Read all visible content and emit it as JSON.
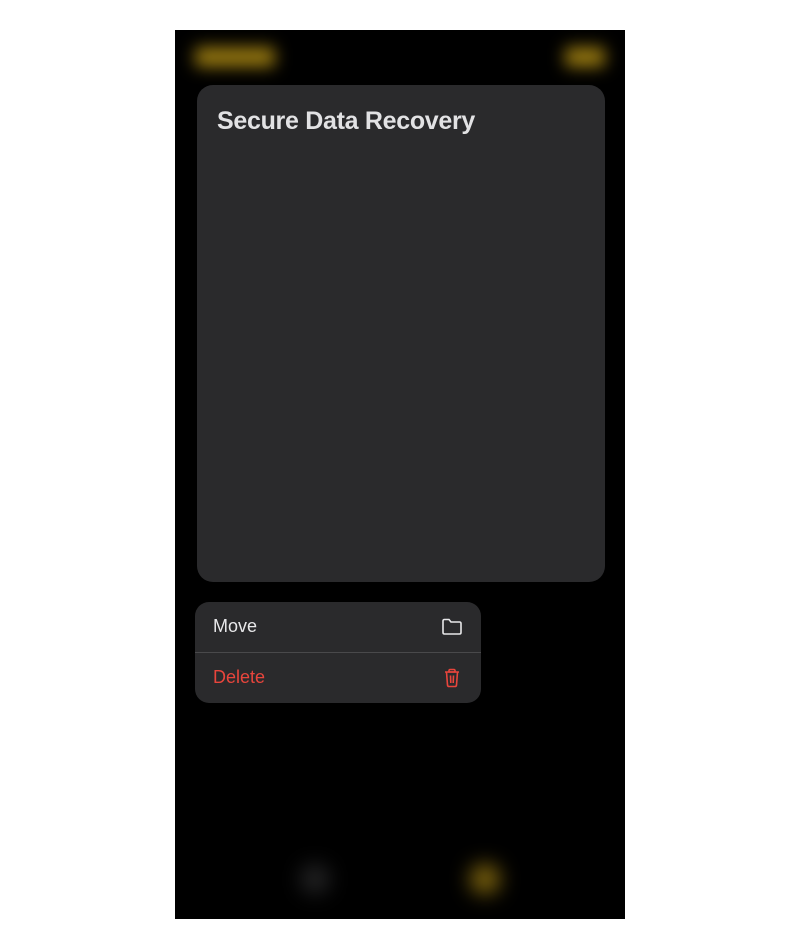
{
  "note": {
    "title": "Secure Data Recovery"
  },
  "context_menu": {
    "move": {
      "label": "Move"
    },
    "delete": {
      "label": "Delete"
    }
  }
}
